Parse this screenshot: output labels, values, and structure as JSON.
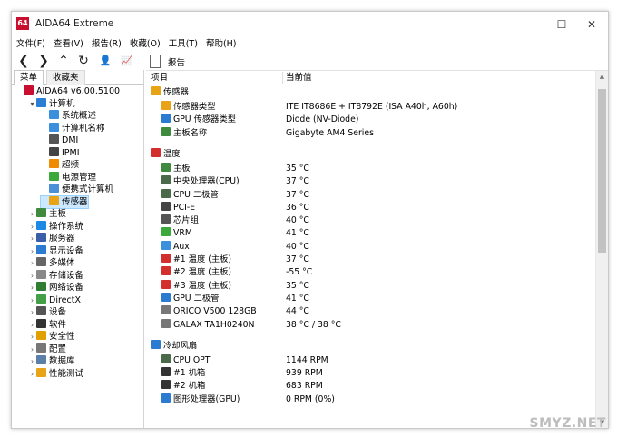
{
  "window": {
    "app_icon_text": "64",
    "title": "AIDA64 Extreme",
    "minimize": "—",
    "maximize": "☐",
    "close": "✕"
  },
  "menu": [
    "文件(F)",
    "查看(V)",
    "报告(R)",
    "收藏(O)",
    "工具(T)",
    "帮助(H)"
  ],
  "toolbar": {
    "back": "❮",
    "forward": "❯",
    "up": "⌃",
    "refresh": "↻",
    "user": "👤",
    "chart": "📈"
  },
  "report_label": "报告",
  "tabs": {
    "menu": "菜单",
    "favorites": "收藏夹"
  },
  "tree": [
    {
      "label": "AIDA64 v6.00.5100",
      "indent": 0,
      "exp": "",
      "icon": "aida-icon",
      "color": "#c8102e"
    },
    {
      "label": "计算机",
      "indent": 1,
      "exp": "v",
      "icon": "computer-icon",
      "color": "#2a7fd4"
    },
    {
      "label": "系统概述",
      "indent": 2,
      "exp": "",
      "icon": "monitor-icon",
      "color": "#3b8fdc"
    },
    {
      "label": "计算机名称",
      "indent": 2,
      "exp": "",
      "icon": "monitor-icon",
      "color": "#3b8fdc"
    },
    {
      "label": "DMI",
      "indent": 2,
      "exp": "",
      "icon": "dmi-icon",
      "color": "#555555"
    },
    {
      "label": "IPMI",
      "indent": 2,
      "exp": "",
      "icon": "ipmi-icon",
      "color": "#444444"
    },
    {
      "label": "超频",
      "indent": 2,
      "exp": "",
      "icon": "flame-icon",
      "color": "#f08a00"
    },
    {
      "label": "电源管理",
      "indent": 2,
      "exp": "",
      "icon": "battery-icon",
      "color": "#3aa83a"
    },
    {
      "label": "便携式计算机",
      "indent": 2,
      "exp": "",
      "icon": "laptop-icon",
      "color": "#4a90d9"
    },
    {
      "label": "传感器",
      "indent": 2,
      "exp": "",
      "icon": "sensor-icon",
      "color": "#e8a317",
      "selected": true
    },
    {
      "label": "主板",
      "indent": 1,
      "exp": ">",
      "icon": "motherboard-icon",
      "color": "#3f8a3f"
    },
    {
      "label": "操作系统",
      "indent": 1,
      "exp": ">",
      "icon": "windows-icon",
      "color": "#1e88e5"
    },
    {
      "label": "服务器",
      "indent": 1,
      "exp": ">",
      "icon": "server-icon",
      "color": "#3a5fa8"
    },
    {
      "label": "显示设备",
      "indent": 1,
      "exp": ">",
      "icon": "display-icon",
      "color": "#2b7bd0"
    },
    {
      "label": "多媒体",
      "indent": 1,
      "exp": ">",
      "icon": "speaker-icon",
      "color": "#666666"
    },
    {
      "label": "存储设备",
      "indent": 1,
      "exp": ">",
      "icon": "storage-icon",
      "color": "#888888"
    },
    {
      "label": "网络设备",
      "indent": 1,
      "exp": ">",
      "icon": "network-icon",
      "color": "#2e7d32"
    },
    {
      "label": "DirectX",
      "indent": 1,
      "exp": ">",
      "icon": "directx-icon",
      "color": "#43a047"
    },
    {
      "label": "设备",
      "indent": 1,
      "exp": ">",
      "icon": "device-icon",
      "color": "#555555"
    },
    {
      "label": "软件",
      "indent": 1,
      "exp": ">",
      "icon": "software-icon",
      "color": "#333333"
    },
    {
      "label": "安全性",
      "indent": 1,
      "exp": ">",
      "icon": "shield-icon",
      "color": "#e0a000"
    },
    {
      "label": "配置",
      "indent": 1,
      "exp": ">",
      "icon": "config-icon",
      "color": "#777777"
    },
    {
      "label": "数据库",
      "indent": 1,
      "exp": ">",
      "icon": "database-icon",
      "color": "#5a7fa8"
    },
    {
      "label": "性能测试",
      "indent": 1,
      "exp": ">",
      "icon": "benchmark-icon",
      "color": "#e8a317"
    }
  ],
  "columns": {
    "item": "项目",
    "value": "当前值"
  },
  "list": [
    {
      "type": "section",
      "label": "传感器",
      "icon": "sensor-icon",
      "color": "#e8a317"
    },
    {
      "type": "item",
      "label": "传感器类型",
      "value": "ITE IT8686E + IT8792E  (ISA A40h, A60h)",
      "icon": "sensor-icon",
      "color": "#e8a317"
    },
    {
      "type": "item",
      "label": "GPU 传感器类型",
      "value": "Diode  (NV-Diode)",
      "icon": "gpu-icon",
      "color": "#2b7bd0"
    },
    {
      "type": "item",
      "label": "主板名称",
      "value": "Gigabyte AM4 Series",
      "icon": "motherboard-icon",
      "color": "#3f8a3f"
    },
    {
      "type": "gap"
    },
    {
      "type": "section",
      "label": "温度",
      "icon": "thermometer-icon",
      "color": "#d32f2f"
    },
    {
      "type": "item",
      "label": "主板",
      "value": "35 °C",
      "icon": "motherboard-icon",
      "color": "#3f8a3f"
    },
    {
      "type": "item",
      "label": "中央处理器(CPU)",
      "value": "37 °C",
      "icon": "cpu-icon",
      "color": "#4a6a4a"
    },
    {
      "type": "item",
      "label": "CPU 二极管",
      "value": "37 °C",
      "icon": "cpu-icon",
      "color": "#4a6a4a"
    },
    {
      "type": "item",
      "label": "PCI-E",
      "value": "36 °C",
      "icon": "pcie-icon",
      "color": "#444444"
    },
    {
      "type": "item",
      "label": "芯片组",
      "value": "40 °C",
      "icon": "chip-icon",
      "color": "#555555"
    },
    {
      "type": "item",
      "label": "VRM",
      "value": "41 °C",
      "icon": "battery-icon",
      "color": "#3aa83a"
    },
    {
      "type": "item",
      "label": "Aux",
      "value": "40 °C",
      "icon": "monitor-icon",
      "color": "#3b8fdc"
    },
    {
      "type": "item",
      "label": "#1 温度 (主板)",
      "value": "37 °C",
      "icon": "thermometer-icon",
      "color": "#d32f2f"
    },
    {
      "type": "item",
      "label": "#2 温度 (主板)",
      "value": "-55 °C",
      "icon": "thermometer-icon",
      "color": "#d32f2f"
    },
    {
      "type": "item",
      "label": "#3 温度 (主板)",
      "value": "35 °C",
      "icon": "thermometer-icon",
      "color": "#d32f2f"
    },
    {
      "type": "item",
      "label": "GPU 二极管",
      "value": "41 °C",
      "icon": "gpu-icon",
      "color": "#2b7bd0"
    },
    {
      "type": "item",
      "label": "ORICO V500 128GB",
      "value": "44 °C",
      "icon": "drive-icon",
      "color": "#777777"
    },
    {
      "type": "item",
      "label": "GALAX TA1H0240N",
      "value": "38 °C / 38 °C",
      "icon": "drive-icon",
      "color": "#777777"
    },
    {
      "type": "gap"
    },
    {
      "type": "section",
      "label": "冷却风扇",
      "icon": "fan-icon",
      "color": "#2b7bd0"
    },
    {
      "type": "item",
      "label": "CPU OPT",
      "value": "1144 RPM",
      "icon": "cpu-icon",
      "color": "#4a6a4a"
    },
    {
      "type": "item",
      "label": "#1 机箱",
      "value": "939 RPM",
      "icon": "case-icon",
      "color": "#333333"
    },
    {
      "type": "item",
      "label": "#2 机箱",
      "value": "683 RPM",
      "icon": "case-icon",
      "color": "#333333"
    },
    {
      "type": "item",
      "label": "图形处理器(GPU)",
      "value": "0 RPM  (0%)",
      "icon": "gpu-icon",
      "color": "#2b7bd0"
    }
  ],
  "watermark": "SMYZ.NET"
}
